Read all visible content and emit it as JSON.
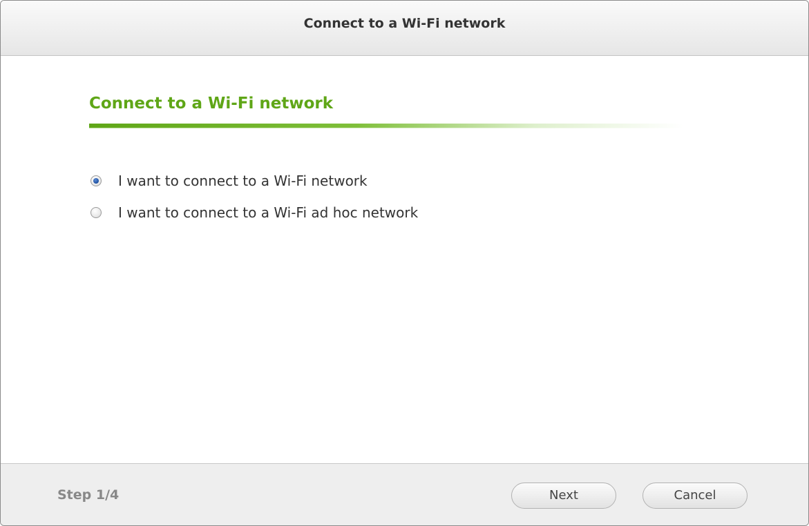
{
  "dialog": {
    "title": "Connect to a Wi-Fi network"
  },
  "content": {
    "heading": "Connect to a Wi-Fi network",
    "options": [
      {
        "label": "I want to connect to a Wi-Fi network",
        "selected": true
      },
      {
        "label": "I want to connect to a Wi-Fi ad hoc network",
        "selected": false
      }
    ]
  },
  "footer": {
    "step": "Step 1/4",
    "next_label": "Next",
    "cancel_label": "Cancel"
  },
  "colors": {
    "heading_green": "#5fa617",
    "radio_selected_blue": "#1d4fa0"
  }
}
